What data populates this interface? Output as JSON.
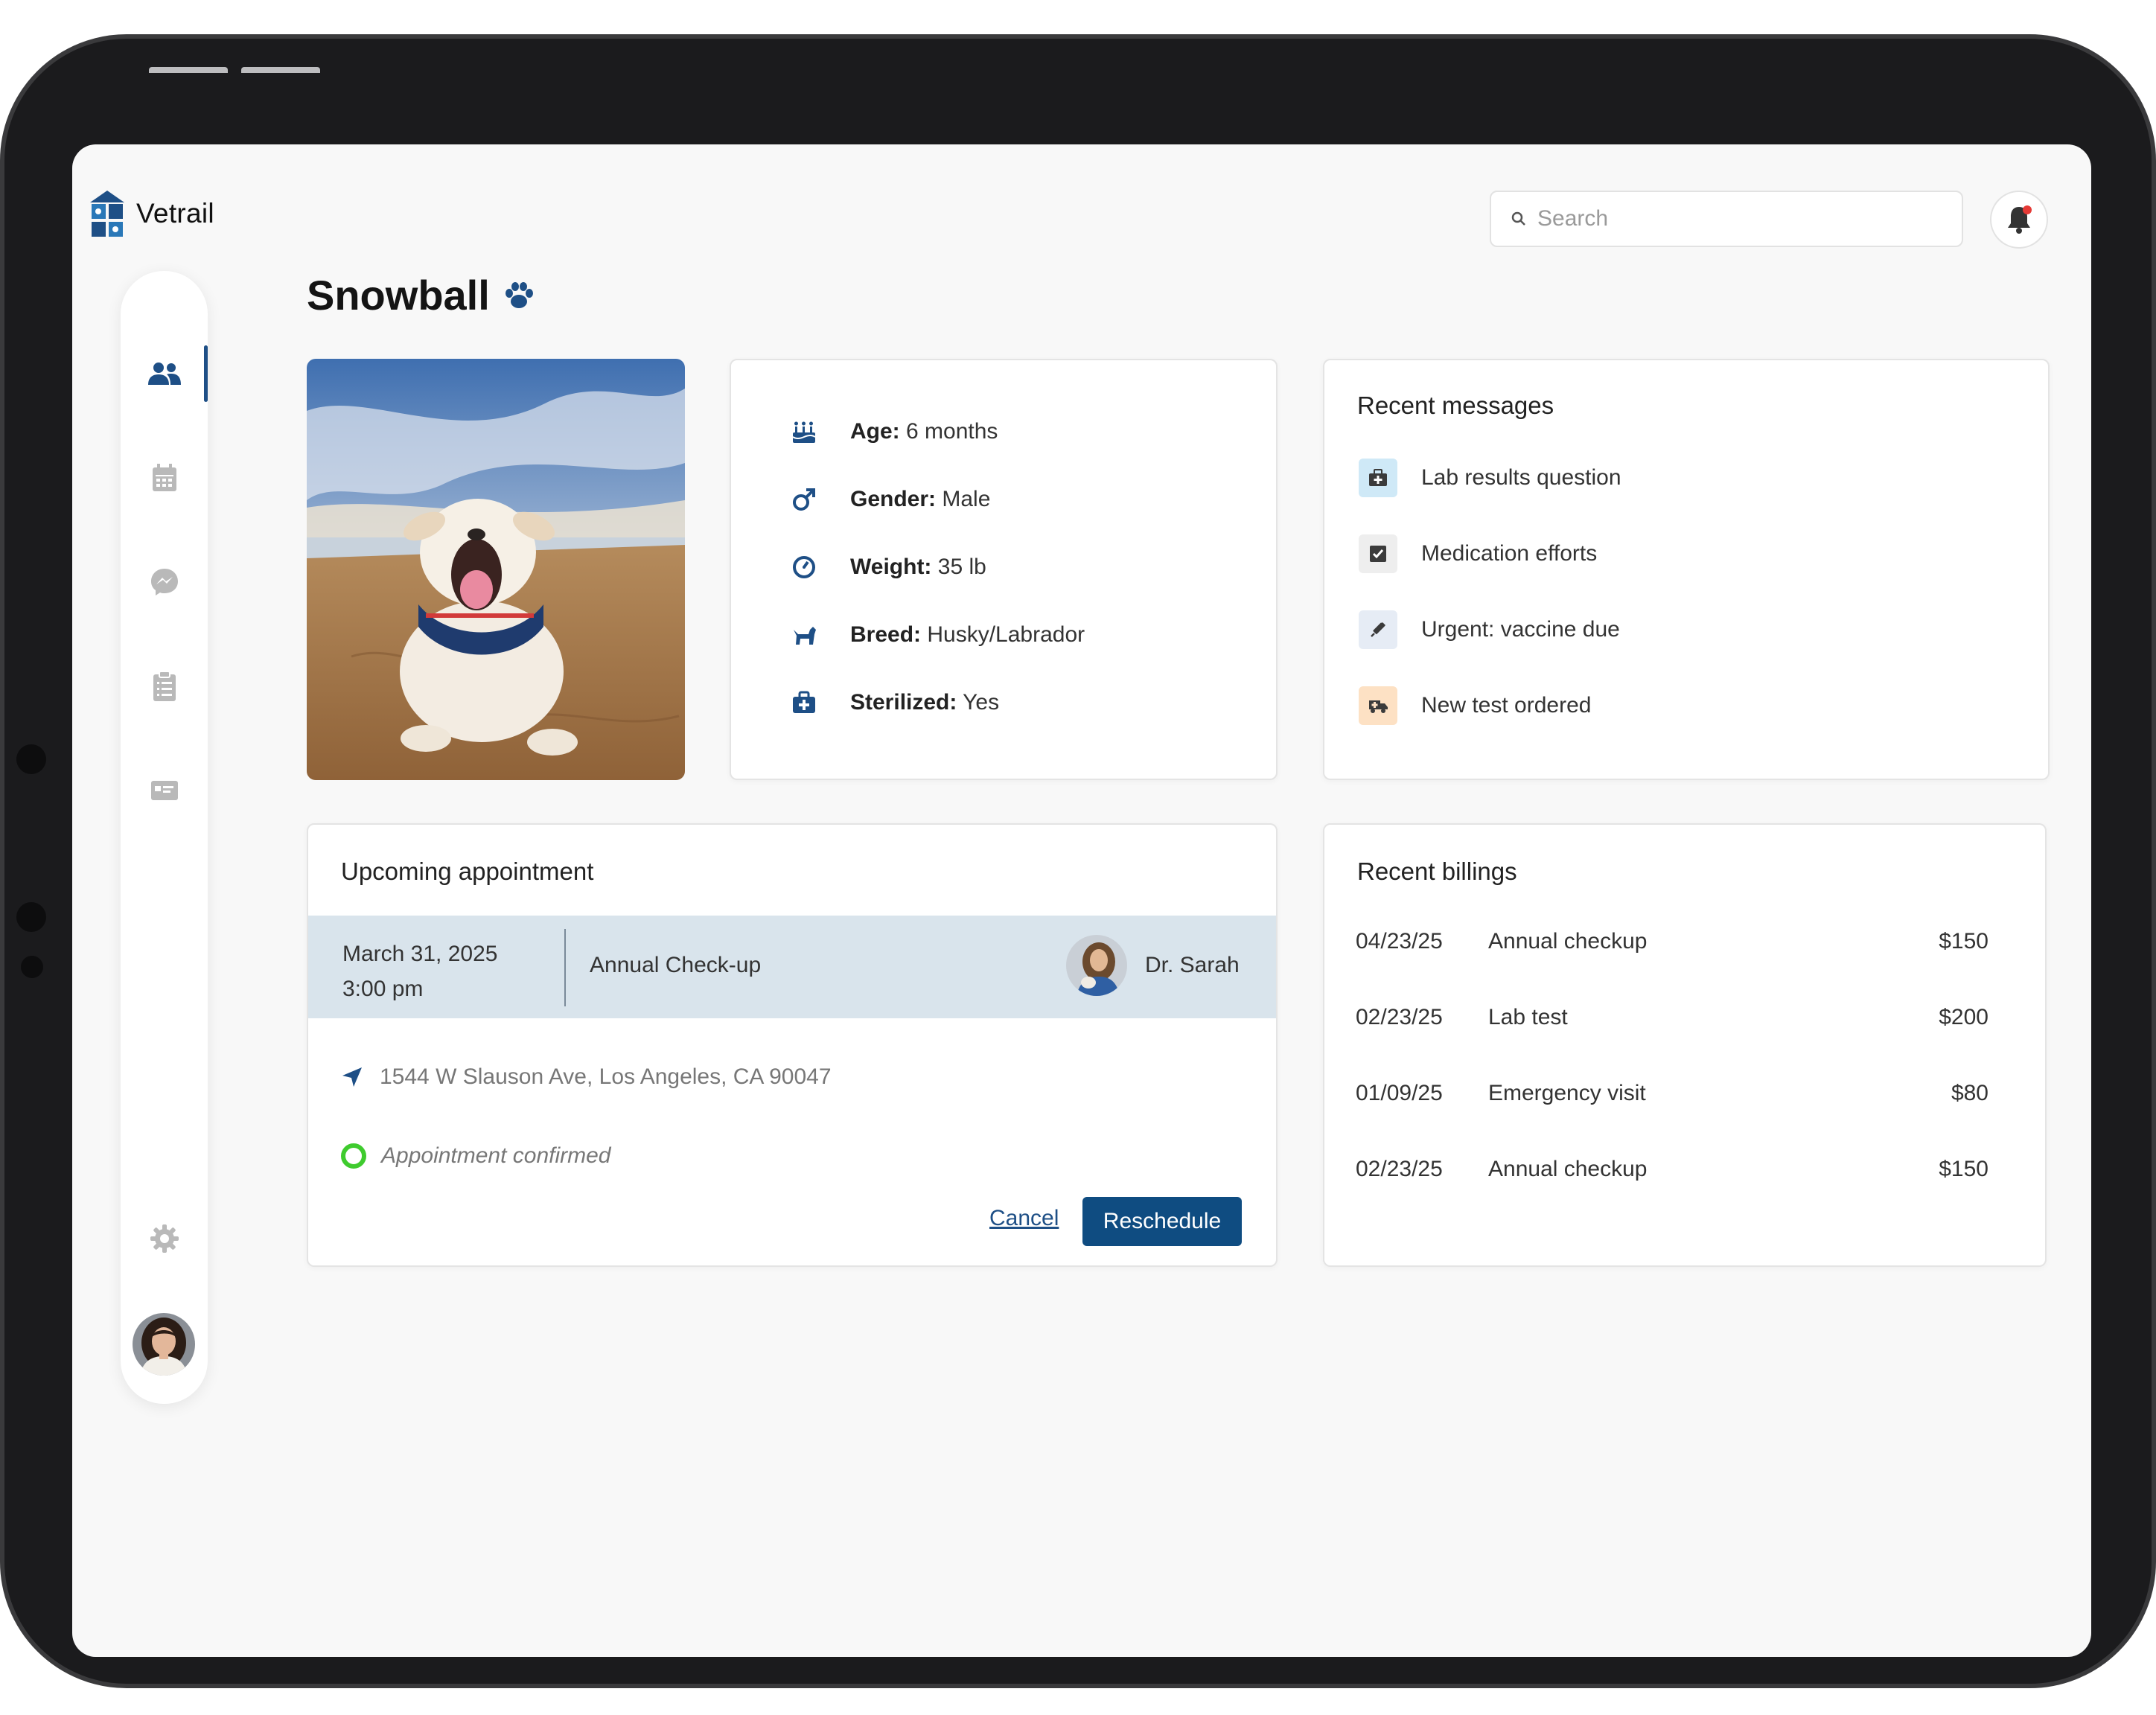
{
  "app": {
    "name": "Vetrail"
  },
  "search": {
    "placeholder": "Search"
  },
  "pet": {
    "name": "Snowball",
    "info": [
      {
        "label": "Age:",
        "value": "6 months",
        "icon": "birthday-cake-icon"
      },
      {
        "label": "Gender:",
        "value": "Male",
        "icon": "male-gender-icon"
      },
      {
        "label": "Weight:",
        "value": "35 lb",
        "icon": "scale-icon"
      },
      {
        "label": "Breed:",
        "value": "Husky/Labrador",
        "icon": "dog-icon"
      },
      {
        "label": "Sterilized:",
        "value": "Yes",
        "icon": "medical-kit-icon"
      }
    ]
  },
  "messages": {
    "title": "Recent messages",
    "items": [
      {
        "text": "Lab results question",
        "icon": "medical-bag-icon",
        "color": "#cfe9f7"
      },
      {
        "text": "Medication efforts",
        "icon": "checkbox-icon",
        "color": "#eeeeee"
      },
      {
        "text": "Urgent: vaccine due",
        "icon": "syringe-icon",
        "color": "#e6ecf5"
      },
      {
        "text": "New test ordered",
        "icon": "ambulance-icon",
        "color": "#fde1c4"
      }
    ]
  },
  "appointment": {
    "title": "Upcoming appointment",
    "date": "March 31, 2025",
    "time": "3:00 pm",
    "type": "Annual Check-up",
    "doctor": "Dr. Sarah",
    "address": "1544 W Slauson Ave, Los Angeles, CA 90047",
    "status": "Appointment confirmed",
    "cancel_label": "Cancel",
    "reschedule_label": "Reschedule"
  },
  "billings": {
    "title": "Recent billings",
    "items": [
      {
        "date": "04/23/25",
        "desc": "Annual checkup",
        "amount": "$150"
      },
      {
        "date": "02/23/25",
        "desc": "Lab test",
        "amount": "$200"
      },
      {
        "date": "01/09/25",
        "desc": "Emergency visit",
        "amount": "$80"
      },
      {
        "date": "02/23/25",
        "desc": "Annual checkup",
        "amount": "$150"
      }
    ]
  },
  "colors": {
    "brand": "#0f4c81",
    "icon_blue": "#1e4f86",
    "band": "#d9e4ec",
    "confirm_green": "#3fcb2e"
  }
}
